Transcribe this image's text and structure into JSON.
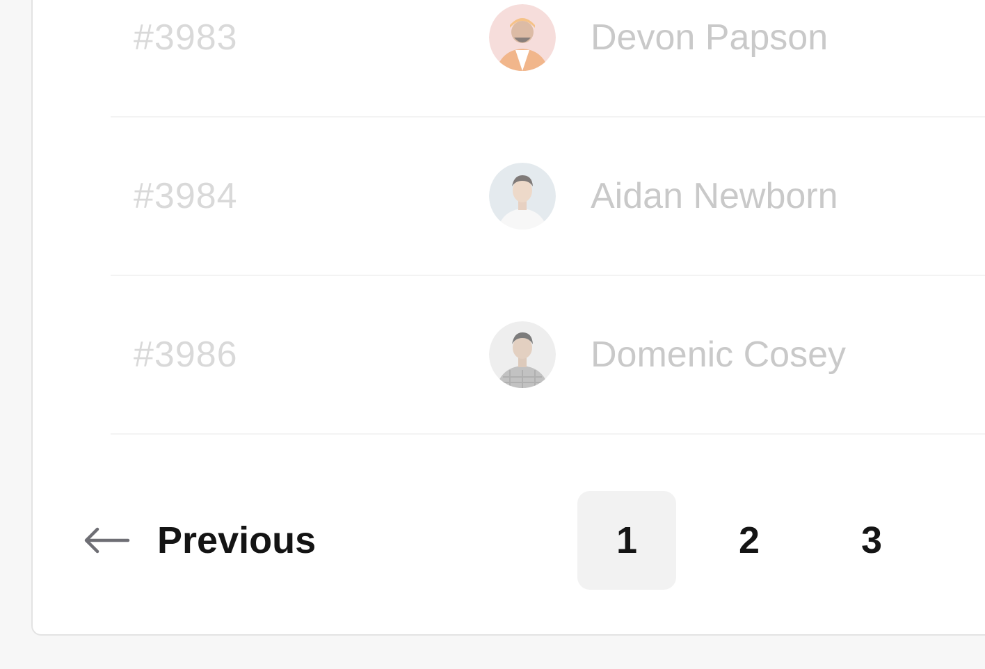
{
  "rows": [
    {
      "id": "#3983",
      "name": "Devon Papson",
      "avatar_icon": "avatar-photo-orange-jacket",
      "avatar_color": "#e8a98a"
    },
    {
      "id": "#3984",
      "name": "Aidan Newborn",
      "avatar_icon": "avatar-photo-man",
      "avatar_color": "#c9d3d9"
    },
    {
      "id": "#3986",
      "name": "Domenic Cosey",
      "avatar_icon": "avatar-photo-man-plaid",
      "avatar_color": "#b9b9b9"
    }
  ],
  "pagination": {
    "previous_label": "Previous",
    "previous_icon": "arrow-left-icon",
    "pages": [
      "1",
      "2",
      "3"
    ],
    "current_page": "1"
  },
  "colors": {
    "text_primary": "#141414",
    "text_muted": "#c9c9c9",
    "active_page_bg": "#f2f2f2"
  }
}
